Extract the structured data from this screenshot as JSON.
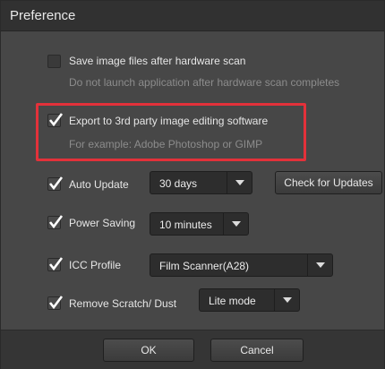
{
  "dialog": {
    "title": "Preference"
  },
  "options": {
    "save_images": {
      "label": "Save image files after hardware scan",
      "sub": "Do not launch application after hardware scan completes",
      "checked": false
    },
    "export": {
      "label": "Export to 3rd party image editing software",
      "sub": "For example: Adobe Photoshop or GIMP",
      "checked": true
    },
    "auto_update": {
      "label": "Auto Update",
      "value": "30 days",
      "checked": true,
      "button": "Check for Updates"
    },
    "power_saving": {
      "label": "Power Saving",
      "value": "10 minutes",
      "checked": true
    },
    "icc_profile": {
      "label": "ICC Profile",
      "value": "Film Scanner(A28)",
      "checked": true
    },
    "remove_scratch": {
      "label": "Remove Scratch/ Dust",
      "value": "Lite mode",
      "checked": true
    }
  },
  "footer": {
    "ok_label": "OK",
    "cancel_label": "Cancel"
  },
  "colors": {
    "highlight": "#e3313a",
    "background": "#474747",
    "titlebar": "#313131"
  }
}
